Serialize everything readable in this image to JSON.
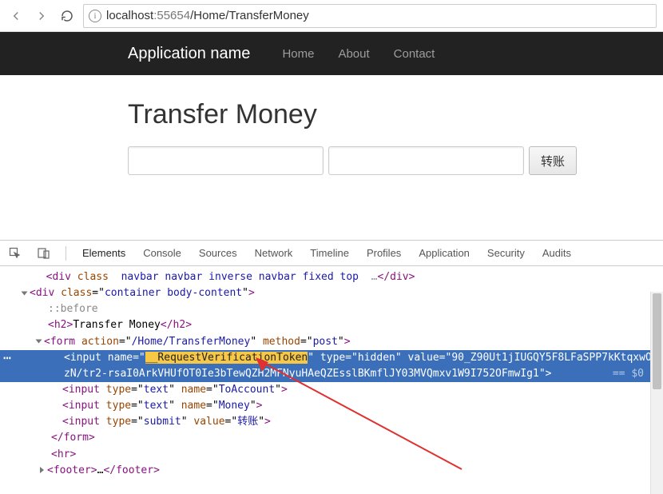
{
  "browser": {
    "url_host": "localhost",
    "url_port": ":55654",
    "url_path": "/Home/TransferMoney"
  },
  "navbar": {
    "brand": "Application name",
    "links": [
      "Home",
      "About",
      "Contact"
    ]
  },
  "page": {
    "heading": "Transfer Money",
    "input1_placeholder": "",
    "input2_placeholder": "",
    "submit_label": "转账"
  },
  "devtools": {
    "tabs": [
      "Elements",
      "Console",
      "Sources",
      "Network",
      "Timeline",
      "Profiles",
      "Application",
      "Security",
      "Audits"
    ],
    "active_tab": "Elements",
    "lines": {
      "l0a": "<div class",
      "l0b": "navbar navbar inverse navbar fixed top",
      "l0c": "…",
      "l0d": "</div>",
      "l1a": "<div ",
      "l1b": "class",
      "l1c": "container body-content",
      "l2": "::before",
      "l3a": "<h2>",
      "l3b": "Transfer Money",
      "l3c": "</h2>",
      "l4a": "<form ",
      "l4b": "action",
      "l4c": "/Home/TransferMoney",
      "l4d": "method",
      "l4e": "post",
      "sel_a": "<input ",
      "sel_name": "name",
      "sel_token": "__RequestVerificationToken",
      "sel_type": "type",
      "sel_hidden": "hidden",
      "sel_value": "value",
      "sel_valtext": "90_Z90Ut1jIUGQY5F8LFaSPP7kKtqxwOzN/tr2-rsaI0ArkVHUfOT0Ie3bTewQZH2MFNyuHAeQZEsslBKmflJY03MVQmxv1W9I752OFmwIg1",
      "sel_eq": " == $0",
      "l6a": "<input ",
      "l6b": "type",
      "l6c": "text",
      "l6d": "name",
      "l6e": "ToAccount",
      "l7e": "Money",
      "l8b": "submit",
      "l8d": "value",
      "l8e": "转账",
      "l9": "</form>",
      "l10": "<hr>",
      "l11a": "<footer>",
      "l11b": "</footer>"
    }
  }
}
